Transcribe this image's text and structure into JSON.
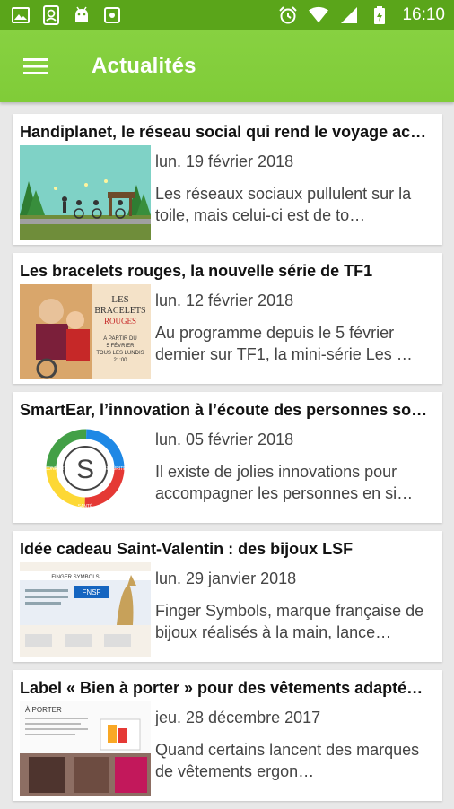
{
  "status_bar": {
    "time": "16:10",
    "icons_left": [
      "image-icon",
      "contact-card-icon",
      "android-icon",
      "camera-icon"
    ],
    "icons_right": [
      "alarm-icon",
      "wifi-icon",
      "signal-icon",
      "battery-charging-icon"
    ]
  },
  "app_bar": {
    "title": "Actualités",
    "menu_icon": "hamburger-menu-icon",
    "color": "#80cc38"
  },
  "articles": [
    {
      "title": "Handiplanet, le réseau social qui rend le voyage ac…",
      "date": "lun. 19 février 2018",
      "excerpt": "Les réseaux sociaux pullulent sur la toile, mais celui-ci est de to…"
    },
    {
      "title": "Les bracelets rouges, la nouvelle série de TF1",
      "date": "lun. 12 février 2018",
      "excerpt": "Au programme depuis le 5 février dernier sur TF1, la mini-série Les …",
      "thumb_text": [
        "LES",
        "BRACELETS",
        "ROUGES",
        "À PARTIR DU",
        "5 FÉVRIER",
        "TOUS LES LUNDIS",
        "21:00"
      ]
    },
    {
      "title": "SmartEar, l’innovation à l’écoute des personnes so…",
      "date": "lun. 05 février 2018",
      "excerpt": "Il existe de jolies innovations pour accompagner les personnes en si…",
      "thumb_text": [
        "S",
        "SANTÉ",
        "SÉCURITÉ",
        "CONFORT"
      ]
    },
    {
      "title": "Idée cadeau Saint-Valentin : des bijoux LSF",
      "date": "lun. 29 janvier 2018",
      "excerpt": "Finger Symbols, marque française de bijoux réalisés à la main, lance…",
      "thumb_text": [
        "FINGER SYMBOLS",
        "FNSF"
      ]
    },
    {
      "title": "Label « Bien à porter » pour des vêtements adapté…",
      "date": "jeu. 28 décembre 2017",
      "excerpt": "Quand certains lancent des marques de vêtements ergon…",
      "thumb_text": [
        "À PORTER"
      ]
    }
  ]
}
